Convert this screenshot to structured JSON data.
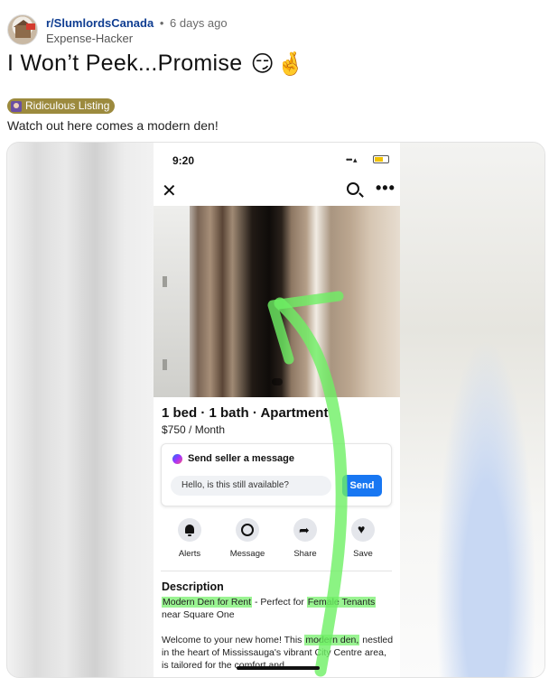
{
  "post": {
    "subreddit": "r/SlumlordsCanada",
    "separator": "•",
    "time": "6 days ago",
    "author": "Expense-Hacker",
    "title": "I Won’t Peek...Promise",
    "title_emoji_1": "😏",
    "title_emoji_2": "🤞",
    "flair": "Ridiculous Listing",
    "body": "Watch out here comes a modern den!"
  },
  "phone": {
    "time": "9:20",
    "signal": "••• ▴",
    "close_icon": "✕",
    "more_icon": "•••",
    "listing_title": "1 bed · 1 bath · Apartment",
    "listing_price": "$750 / Month",
    "message_card": {
      "heading": "Send seller a message",
      "input_value": "Hello, is this still available?",
      "send_label": "Send"
    },
    "actions": [
      {
        "label": "Alerts",
        "icon": "bell-icon"
      },
      {
        "label": "Message",
        "icon": "messenger-icon"
      },
      {
        "label": "Share",
        "icon": "share-icon"
      },
      {
        "label": "Save",
        "icon": "heart-icon"
      }
    ],
    "description": {
      "heading": "Description",
      "line1_hl1": "Modern Den for Rent",
      "line1_mid": " - Perfect for ",
      "line1_hl2": "Female Tenants",
      "line2": "near Square One",
      "p2_start": "Welcome to your new home! This ",
      "p2_hl": "modern den,",
      "p2_rest": " nestled in the heart of Mississauga's vibrant City Centre area, is tailored for the comfort and"
    }
  },
  "colors": {
    "subreddit": "#0f3d91",
    "flair_bg": "#9c8a3e",
    "send_button": "#1877f2",
    "highlight": "#78f06e"
  }
}
